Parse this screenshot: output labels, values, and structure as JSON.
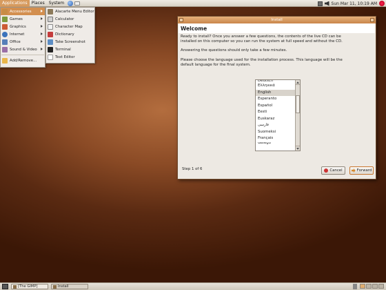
{
  "top_panel": {
    "menus": [
      "Applications",
      "Places",
      "System"
    ],
    "clock": "Sun Mar 11, 10:19 AM"
  },
  "applications_menu": {
    "items": [
      {
        "label": "Accessories",
        "icon": "accessories-icon",
        "submenu": true
      },
      {
        "label": "Games",
        "icon": "games-icon",
        "submenu": true
      },
      {
        "label": "Graphics",
        "icon": "graphics-icon",
        "submenu": true
      },
      {
        "label": "Internet",
        "icon": "internet-icon",
        "submenu": true
      },
      {
        "label": "Office",
        "icon": "office-icon",
        "submenu": true
      },
      {
        "label": "Sound & Video",
        "icon": "sound-video-icon",
        "submenu": true
      }
    ],
    "add_remove": "Add/Remove..."
  },
  "accessories_menu": {
    "items": [
      {
        "label": "Alacarte Menu Editor",
        "icon": "menu-editor-icon"
      },
      {
        "label": "Calculator",
        "icon": "calculator-icon"
      },
      {
        "label": "Character Map",
        "icon": "character-map-icon"
      },
      {
        "label": "Dictionary",
        "icon": "dictionary-icon"
      },
      {
        "label": "Take Screenshot",
        "icon": "screenshot-icon"
      },
      {
        "label": "Terminal",
        "icon": "terminal-icon"
      },
      {
        "label": "Text Editor",
        "icon": "text-editor-icon"
      }
    ]
  },
  "install_window": {
    "title": "Install",
    "heading": "Welcome",
    "paragraph1": "Ready to install? Once you answer a few questions, the contents of the live CD can be installed on this computer so you can run the system at full speed and without the CD.",
    "paragraph2": "Answering the questions should only take a few minutes.",
    "paragraph3": "Please choose the language used for the installation process. This language will be the default language for the final system.",
    "languages": [
      "Deutsch",
      "Ελληνικά",
      "English",
      "Esperanto",
      "Español",
      "Eesti",
      "Euskaraz",
      "فارسی",
      "Suomeksi",
      "Français",
      "Galego"
    ],
    "selected_language": "English",
    "step": "Step 1 of 6",
    "cancel_label": "Cancel",
    "forward_label": "Forward"
  },
  "bottom_panel": {
    "tasks": [
      "[The GIMP]",
      "Install"
    ]
  }
}
